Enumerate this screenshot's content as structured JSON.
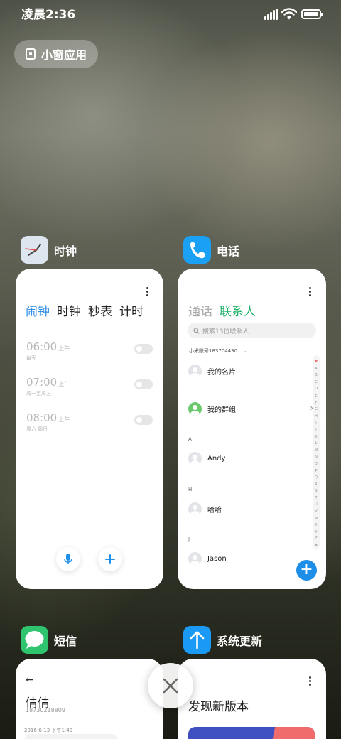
{
  "status_bar": {
    "time": "凌晨2:36",
    "signal_icon": "signal-icon",
    "wifi_icon": "wifi-icon",
    "battery_icon": "battery-icon"
  },
  "floating_window_button": {
    "label": "小窗应用",
    "icon": "small-window-icon"
  },
  "apps": {
    "clock": {
      "name": "时钟",
      "tabs": [
        "闹钟",
        "时钟",
        "秒表",
        "计时"
      ],
      "active_tab": "闹钟",
      "alarms": [
        {
          "time": "06:00",
          "ampm": "上午",
          "days": "每天"
        },
        {
          "time": "07:00",
          "ampm": "上午",
          "days": "周一至周五"
        },
        {
          "time": "08:00",
          "ampm": "上午",
          "days": "周六 周日"
        }
      ],
      "mic_icon": "microphone-icon",
      "add_icon": "plus-icon"
    },
    "phone": {
      "name": "电话",
      "tabs": [
        "通话",
        "联系人"
      ],
      "active_tab": "联系人",
      "search_placeholder": "搜索13位联系人",
      "account": "小米账号183704430",
      "rows": [
        {
          "type": "contact",
          "name": "我的名片"
        },
        {
          "type": "group",
          "name": "我的群组"
        },
        {
          "type": "section",
          "name": "A"
        },
        {
          "type": "contact",
          "name": "Andy"
        },
        {
          "type": "section",
          "name": "H"
        },
        {
          "type": "contact",
          "name": "哈哈"
        },
        {
          "type": "section",
          "name": "J"
        },
        {
          "type": "contact",
          "name": "Jason"
        }
      ],
      "alphabet": [
        "♥",
        "A",
        "B",
        "C",
        "D",
        "E",
        "F",
        "G",
        "H",
        "I",
        "J",
        "K",
        "L",
        "M",
        "N",
        "O",
        "P",
        "Q",
        "R",
        "S",
        "T",
        "U",
        "V",
        "W",
        "X",
        "Y",
        "Z",
        "#"
      ],
      "fab_label": "+"
    },
    "messages": {
      "name": "短信",
      "back_icon": "back-arrow-icon",
      "contact_name": "倩倩",
      "contact_number": "18730218809",
      "message_time": "2016-6-13 下午1:49"
    },
    "updater": {
      "name": "系统更新",
      "heading": "发现新版本"
    }
  },
  "close_all_icon": "close-icon",
  "colors": {
    "clock_accent": "#2f8ee6",
    "contacts_accent": "#1fb36a",
    "fab": "#1e8fe8"
  }
}
